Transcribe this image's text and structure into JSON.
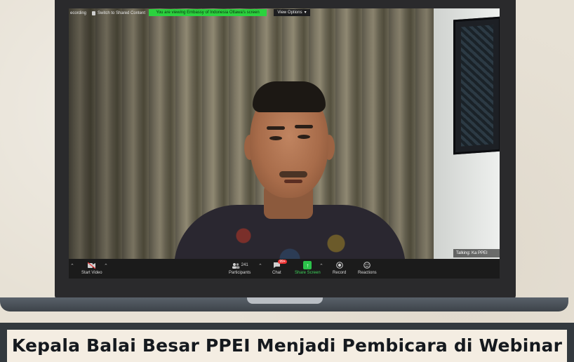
{
  "zoom_window": {
    "top_bar": {
      "recording_label": "ecording",
      "switch_label": "Switch to Shared Content",
      "viewing_banner": "You are viewing Embassy of Indonesia Ottawa's screen",
      "view_options_label": "View Options"
    },
    "speaker_label": "Talking: Ka PPEI",
    "toolbar": {
      "start_video": "Start Video",
      "participants": "Participants",
      "participants_count": "241",
      "chat": "Chat",
      "chat_badge": "99+",
      "share_screen": "Share Screen",
      "record": "Record",
      "reactions": "Reactions"
    }
  },
  "caption": {
    "title": "Kepala Balai Besar PPEI Menjadi Pembicara di Webinar"
  },
  "colors": {
    "share_accent": "#2bc24a",
    "banner_green": "#2bd23e",
    "toolbar_bg": "#1b1b1b",
    "caption_bg": "#f4ede2",
    "laptop_frame": "#2a2a2c"
  },
  "icons": [
    "camera-off-icon",
    "participants-icon",
    "chat-icon",
    "share-screen-icon",
    "record-icon",
    "reactions-icon",
    "pin-icon",
    "chevron-down-icon"
  ]
}
